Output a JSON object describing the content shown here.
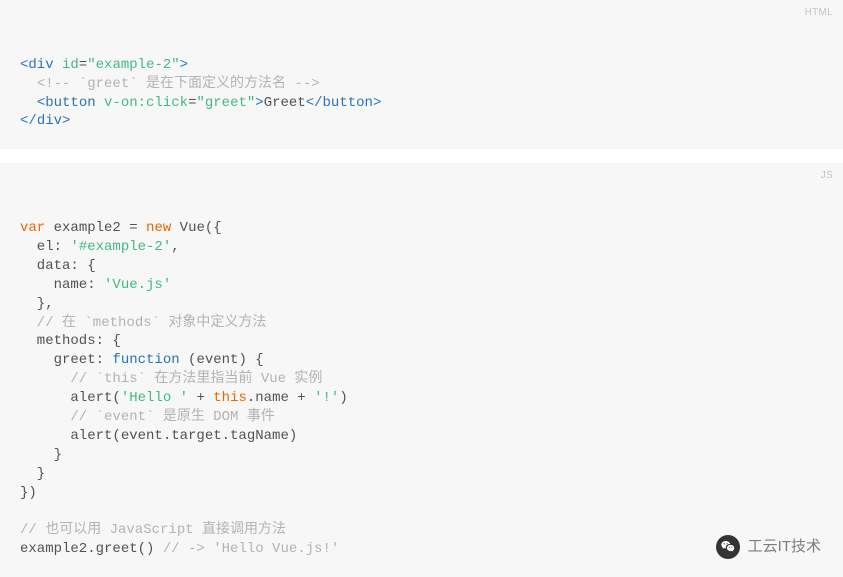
{
  "block1": {
    "lang": "HTML",
    "l1": {
      "p0": "<",
      "tag": "div",
      "sp": " ",
      "attr": "id",
      "eq": "=",
      "val": "\"example-2\"",
      "p1": ">"
    },
    "l2": {
      "text": "<!-- `greet` 是在下面定义的方法名 -->"
    },
    "l3": {
      "p0": "<",
      "tag": "button",
      "sp": " ",
      "attr": "v-on:click",
      "eq": "=",
      "val": "\"greet\"",
      "p1": ">",
      "content": "Greet",
      "p2": "</",
      "tag2": "button",
      "p3": ">"
    },
    "l4": {
      "p0": "</",
      "tag": "div",
      "p1": ">"
    }
  },
  "block2": {
    "lang": "JS",
    "l1": {
      "kw_var": "var",
      "t1": " example2 = ",
      "kw_new": "new",
      "t2": " Vue({"
    },
    "l2": {
      "t1": "  el: ",
      "str": "'#example-2'",
      "t2": ","
    },
    "l3": "  data: {",
    "l4": {
      "t1": "    name: ",
      "str": "'Vue.js'"
    },
    "l5": "  },",
    "l6": "  // 在 `methods` 对象中定义方法",
    "l7": "  methods: {",
    "l8": {
      "t1": "    greet: ",
      "kw_fn": "function",
      "t2": " (",
      "arg": "event",
      "t3": ") {"
    },
    "l9": "      // `this` 在方法里指当前 Vue 实例",
    "l10": {
      "t1": "      alert(",
      "s1": "'Hello '",
      "t2": " + ",
      "kw_this": "this",
      "t3": ".name + ",
      "s2": "'!'",
      "t4": ")"
    },
    "l11": "      // `event` 是原生 DOM 事件",
    "l12": "      alert(event.target.tagName)",
    "l13": "    }",
    "l14": "  }",
    "l15": "})",
    "l16": "",
    "l17": "// 也可以用 JavaScript 直接调用方法",
    "l18": {
      "t1": "example2.greet() ",
      "c": "// -> 'Hello Vue.js!'"
    }
  },
  "watermark": "工云IT技术"
}
